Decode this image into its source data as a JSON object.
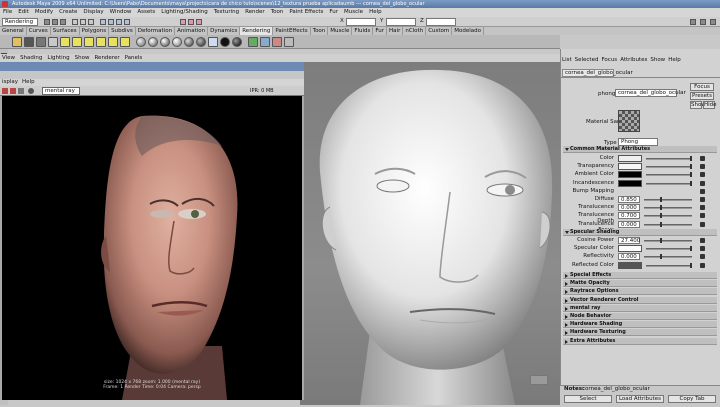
{
  "window": {
    "title": "Autodesk Maya 2009 x64 Unlimited: C:\\Users\\Pabo\\Documents\\maya\\projects\\cara de chico tuto\\scenes\\12_textura prueba aplicadaumb --- cornea_del_globo_ocular"
  },
  "menubar": [
    "File",
    "Edit",
    "Modify",
    "Create",
    "Display",
    "Window",
    "Assets",
    "Lighting/Shading",
    "Texturing",
    "Render",
    "Toon",
    "Paint Effects",
    "Fur",
    "Muscle",
    "Help"
  ],
  "status": {
    "mode": "Rendering",
    "x_label": "X",
    "y_label": "Y",
    "z_label": "Z"
  },
  "shelf_tabs": [
    "General",
    "Curves",
    "Surfaces",
    "Polygons",
    "Subdivs",
    "Deformation",
    "Animation",
    "Dynamics",
    "Rendering",
    "PaintEffects",
    "Toon",
    "Muscle",
    "Fluids",
    "Fur",
    "Hair",
    "nCloth",
    "Custom",
    "Modelado"
  ],
  "shelf_active": "Rendering",
  "viewport_menu": [
    "View",
    "Shading",
    "Lighting",
    "Show",
    "Renderer",
    "Panels"
  ],
  "render_view": {
    "title": "",
    "menu": [
      "isplay",
      "Help"
    ],
    "renderer": "mental ray",
    "ipr": "IPR: 0 MB",
    "info_line1": "size: 1024 x 768  zoom: 1.000     (mental ray)",
    "info_line2": "Frame: 1     Render Time: 0:04     Camera: persp"
  },
  "attribute_editor": {
    "menu": [
      "List",
      "Selected",
      "Focus",
      "Attributes",
      "Show",
      "Help"
    ],
    "tab": "cornea_del_globo_ocular",
    "node_label": "phong:",
    "node_value": "cornea_del_globo_ocular",
    "buttons": {
      "focus": "Focus",
      "presets": "Presets",
      "show": "Show",
      "hide": "Hide"
    },
    "material_sample": "Material Sample",
    "type_label": "Type",
    "type_value": "Phong",
    "common_section": "Common Material Attributes",
    "common_attrs": [
      {
        "label": "Color",
        "value": "",
        "kind": "swatch",
        "color": "#f0f0f0"
      },
      {
        "label": "Transparency",
        "value": "",
        "kind": "swatch",
        "color": "#f6f6f6"
      },
      {
        "label": "Ambient Color",
        "value": "",
        "kind": "swatch",
        "color": "#000000"
      },
      {
        "label": "Incandescence",
        "value": "",
        "kind": "swatch",
        "color": "#000000"
      },
      {
        "label": "Bump Mapping",
        "value": "",
        "kind": "plain"
      },
      {
        "label": "Diffuse",
        "value": "0.850",
        "kind": "num"
      },
      {
        "label": "Translucence",
        "value": "0.000",
        "kind": "num"
      },
      {
        "label": "Translucence Depth",
        "value": "0.700",
        "kind": "num"
      },
      {
        "label": "Translucence Focus",
        "value": "0.000",
        "kind": "num"
      }
    ],
    "specular_section": "Specular Shading",
    "specular_attrs": [
      {
        "label": "Cosine Power",
        "value": "27.400",
        "kind": "num"
      },
      {
        "label": "Specular Color",
        "value": "",
        "kind": "swatch",
        "color": "#ffffff"
      },
      {
        "label": "Reflectivity",
        "value": "0.000",
        "kind": "num"
      },
      {
        "label": "Reflected Color",
        "value": "",
        "kind": "swatch",
        "color": "#555555"
      }
    ],
    "collapsed_sections": [
      "Special Effects",
      "Matte Opacity",
      "Raytrace Options",
      "Vector Renderer Control",
      "mental ray",
      "Node Behavior",
      "Hardware Shading",
      "Hardware Texturing",
      "Extra Attributes"
    ],
    "notes_label": "Notes:",
    "notes_value": "cornea_del_globo_ocular",
    "bottom_buttons": [
      "Select",
      "Load Attributes",
      "Copy Tab"
    ]
  },
  "colors": {
    "titlebar": "#6d8ab4",
    "panel": "#d2d2d2"
  }
}
